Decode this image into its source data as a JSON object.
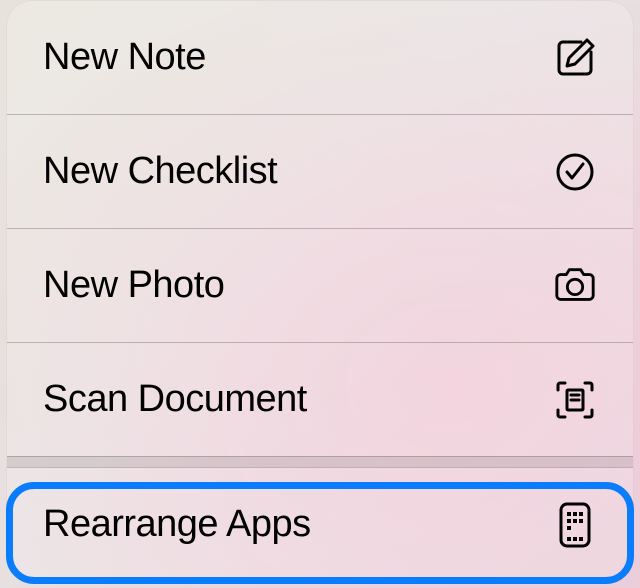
{
  "menu": {
    "items": [
      {
        "label": "New Note",
        "icon": "compose-icon"
      },
      {
        "label": "New Checklist",
        "icon": "checkmark-circle-icon"
      },
      {
        "label": "New Photo",
        "icon": "camera-icon"
      },
      {
        "label": "Scan Document",
        "icon": "document-scanner-icon"
      },
      {
        "label": "Rearrange Apps",
        "icon": "apps-iphone-icon"
      }
    ]
  },
  "highlighted_index": 4
}
